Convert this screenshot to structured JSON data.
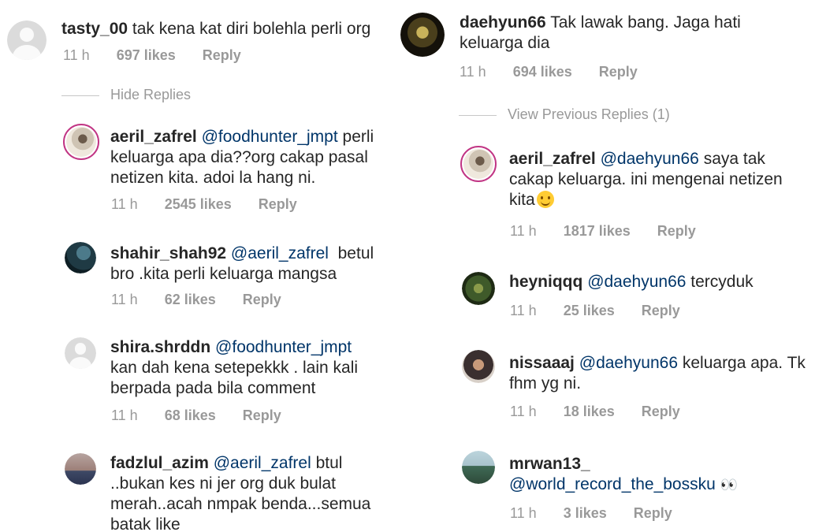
{
  "left": {
    "top_comment": {
      "username": "tasty_00",
      "text": "tak kena kat diri bolehla perli org",
      "time": "11 h",
      "likes": "697 likes",
      "reply": "Reply"
    },
    "toggle": "Hide Replies",
    "replies": [
      {
        "username": "aeril_zafrel",
        "mention": "@foodhunter_jmpt",
        "text_line1": "perli",
        "text_rest": "keluarga apa dia??org cakap pasal netizen kita. adoi la hang ni.",
        "time": "11 h",
        "likes": "2545 likes",
        "reply": "Reply"
      },
      {
        "username": "shahir_shah92",
        "mention": "@aeril_zafrel",
        "text_line1": "betul",
        "text_rest": "bro .kita perli keluarga mangsa",
        "time": "11 h",
        "likes": "62 likes",
        "reply": "Reply"
      },
      {
        "username": "shira.shrddn",
        "mention": "@foodhunter_jmpt",
        "text_rest": "kan dah kena setepekkk . lain kali berpada pada bila comment",
        "time": "11 h",
        "likes": "68 likes",
        "reply": "Reply"
      },
      {
        "username": "fadzlul_azim",
        "mention": "@aeril_zafrel",
        "text_rest": "btul ..bukan kes ni jer org duk bulat merah..acah nmpak benda...semua batak like"
      }
    ]
  },
  "right": {
    "top_comment": {
      "username": "daehyun66",
      "text": "Tak lawak bang. Jaga hati keluarga dia",
      "time": "11 h",
      "likes": "694 likes",
      "reply": "Reply"
    },
    "toggle": "View Previous Replies (1)",
    "replies": [
      {
        "username": "aeril_zafrel",
        "mention": "@daehyun66",
        "text_rest": "saya tak cakap keluarga. ini mengenai netizen kita",
        "time": "11 h",
        "likes": "1817 likes",
        "reply": "Reply"
      },
      {
        "username": "heyniqqq",
        "mention": "@daehyun66",
        "text_rest": "tercyduk",
        "time": "11 h",
        "likes": "25 likes",
        "reply": "Reply"
      },
      {
        "username": "nissaaaj",
        "mention": "@daehyun66",
        "text_rest": "keluarga apa. Tk fhm yg ni.",
        "time": "11 h",
        "likes": "18 likes",
        "reply": "Reply"
      },
      {
        "username": "mrwan13_",
        "mention": "@world_record_the_bossku",
        "eyes": "👀",
        "time": "11 h",
        "likes": "3 likes",
        "reply": "Reply"
      }
    ]
  },
  "colors": {
    "mention": "#003569",
    "meta": "#999999",
    "text": "#262626",
    "story_ring": "#c13584"
  }
}
